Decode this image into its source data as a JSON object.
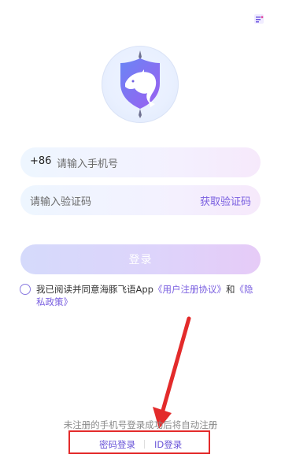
{
  "phone": {
    "country_code": "+86",
    "placeholder": "请输入手机号"
  },
  "verification": {
    "placeholder": "请输入验证码",
    "get_code_label": "获取验证码"
  },
  "login_button": {
    "label": "登录"
  },
  "agreement": {
    "checked": false,
    "prefix": "我已阅读并同意海豚飞语App",
    "user_agreement": "《用户注册协议》",
    "and": "和",
    "privacy_policy": "《隐私政策》"
  },
  "hint": {
    "text": "未注册的手机号登录成功后将自动注册"
  },
  "alt_login": {
    "password_label": "密码登录",
    "id_label": "ID登录"
  },
  "icons": {
    "top_right": "menu-icon",
    "logo": "dolphin-logo"
  },
  "colors": {
    "accent": "#7a5fe0",
    "highlight": "#e32b2b"
  }
}
